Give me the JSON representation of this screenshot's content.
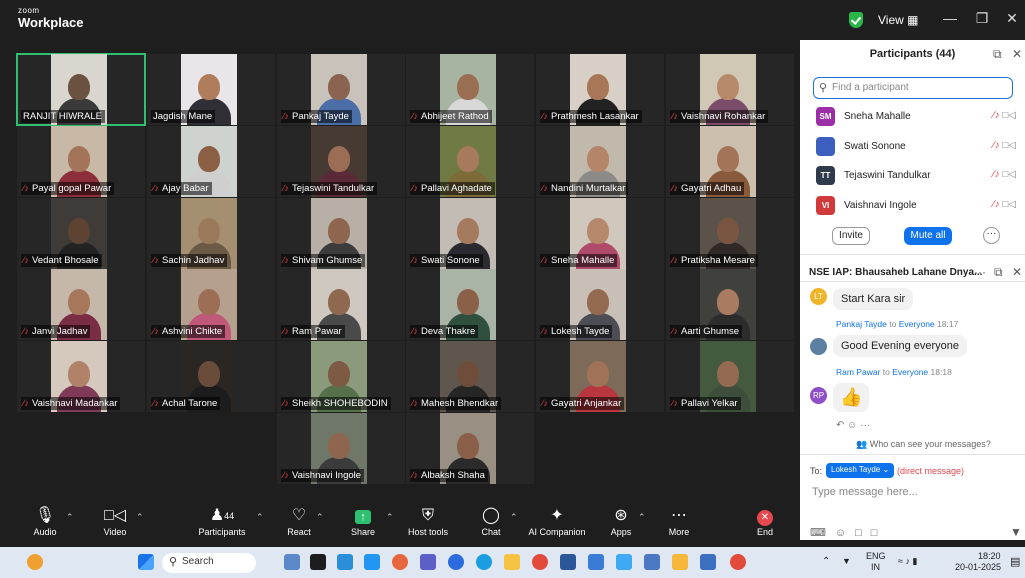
{
  "titlebar": {
    "brand_small": "zoom",
    "brand_big": "Workplace",
    "view_label": "View ▦"
  },
  "gallery": {
    "tiles": [
      {
        "name": "RANJIT HIWRALE",
        "mic_muted": false,
        "active": true,
        "skin": "#6b5140",
        "shirt": "#3a3a3a",
        "bg": "#d9d6cf"
      },
      {
        "name": "Jagdish Mane",
        "mic_muted": false,
        "active": false,
        "skin": "#b07d5c",
        "shirt": "#2f2f35",
        "bg": "#e9e6ea"
      },
      {
        "name": "Pankaj Tayde",
        "mic_muted": true,
        "active": false,
        "skin": "#8a6450",
        "shirt": "#4b6ea8",
        "bg": "#c9c2ba"
      },
      {
        "name": "Abhijeet Rathod",
        "mic_muted": true,
        "active": false,
        "skin": "#9a6e52",
        "shirt": "#d8d8d8",
        "bg": "#a7b4a2"
      },
      {
        "name": "Prathmesh Lasankar",
        "mic_muted": true,
        "active": false,
        "skin": "#a77758",
        "shirt": "#222",
        "bg": "#d8cfc6"
      },
      {
        "name": "Vaishnavi Rohankar",
        "mic_muted": true,
        "active": false,
        "skin": "#b88a6c",
        "shirt": "#7a4d6b",
        "bg": "#d1c7b5"
      },
      {
        "name": "Payal gopal Pawar",
        "mic_muted": true,
        "active": false,
        "skin": "#a3745a",
        "shirt": "#8c2f3a",
        "bg": "#c8b9a7"
      },
      {
        "name": "Ajay Babar",
        "mic_muted": true,
        "active": false,
        "skin": "#8a5f44",
        "shirt": "#cfcfcf",
        "bg": "#cfd3d0"
      },
      {
        "name": "Tejaswini Tandulkar",
        "mic_muted": true,
        "active": false,
        "skin": "#9c6d55",
        "shirt": "#5b2a38",
        "bg": "#473a33"
      },
      {
        "name": "Pallavi Aghadate",
        "mic_muted": true,
        "active": false,
        "skin": "#a87a5d",
        "shirt": "#7d6b3a",
        "bg": "#6f7a44"
      },
      {
        "name": "Nandini Murtalkar",
        "mic_muted": true,
        "active": false,
        "skin": "#b48569",
        "shirt": "#8d8b88",
        "bg": "#c1b9ac"
      },
      {
        "name": "Gayatri Adhau",
        "mic_muted": true,
        "active": false,
        "skin": "#a47458",
        "shirt": "#8a5a3d",
        "bg": "#cdbfae"
      },
      {
        "name": "Vedant Bhosale",
        "mic_muted": true,
        "active": false,
        "skin": "#5e4232",
        "shirt": "#232323",
        "bg": "#3f3b38"
      },
      {
        "name": "Sachin Jadhav",
        "mic_muted": true,
        "active": false,
        "skin": "#9b7a5c",
        "shirt": "#6b5a45",
        "bg": "#a58f71"
      },
      {
        "name": "Shivam Ghumse",
        "mic_muted": true,
        "active": false,
        "skin": "#8e6650",
        "shirt": "#3c3c3c",
        "bg": "#b8b0a6"
      },
      {
        "name": "Swati Sonone",
        "mic_muted": true,
        "active": false,
        "skin": "#a57a5f",
        "shirt": "#2a2a30",
        "bg": "#c2bcb4"
      },
      {
        "name": "Sneha Mahalle",
        "mic_muted": true,
        "active": false,
        "skin": "#b7896c",
        "shirt": "#b04a6a",
        "bg": "#d1c8bd"
      },
      {
        "name": "Pratiksha Mesare",
        "mic_muted": true,
        "active": false,
        "skin": "#7a5642",
        "shirt": "#2f2a28",
        "bg": "#5b524a"
      },
      {
        "name": "Janvi Jadhav",
        "mic_muted": true,
        "active": false,
        "skin": "#a7775b",
        "shirt": "#7a2e45",
        "bg": "#c5b8aa"
      },
      {
        "name": "Ashvini Chikte",
        "mic_muted": true,
        "active": false,
        "skin": "#9c6e55",
        "shirt": "#c0587a",
        "bg": "#b4a08c"
      },
      {
        "name": "Ram Pawar",
        "mic_muted": true,
        "active": false,
        "skin": "#8f6850",
        "shirt": "#4a4a4a",
        "bg": "#cfc8c0"
      },
      {
        "name": "Deva Thakre",
        "mic_muted": true,
        "active": false,
        "skin": "#8a6048",
        "shirt": "#2f4f3f",
        "bg": "#a9b4a6"
      },
      {
        "name": "Lokesh Tayde",
        "mic_muted": true,
        "active": false,
        "skin": "#93694f",
        "shirt": "#4d4d55",
        "bg": "#c8c0b6"
      },
      {
        "name": "Aarti Ghumse",
        "mic_muted": true,
        "active": false,
        "skin": "#a97c62",
        "shirt": "#2c2c2c",
        "bg": "#40403c"
      },
      {
        "name": "Vaishnavi Madankar",
        "mic_muted": true,
        "active": false,
        "skin": "#b0826a",
        "shirt": "#7f3a58",
        "bg": "#d4c9bc"
      },
      {
        "name": "Achal Tarone",
        "mic_muted": true,
        "active": false,
        "skin": "#6a4c3a",
        "shirt": "#1c1c1c",
        "bg": "#2a2623"
      },
      {
        "name": "Sheikh SHOHEBODIN",
        "mic_muted": true,
        "active": false,
        "skin": "#7d5a44",
        "shirt": "#55704a",
        "bg": "#8c9a7c"
      },
      {
        "name": "Mahesh Bhendkar",
        "mic_muted": true,
        "active": false,
        "skin": "#6e4e3a",
        "shirt": "#262626",
        "bg": "#5f564d"
      },
      {
        "name": "Gayatri Anjankar",
        "mic_muted": true,
        "active": false,
        "skin": "#a07258",
        "shirt": "#b8363e",
        "bg": "#7e6a58"
      },
      {
        "name": "Pallavi Yelkar",
        "mic_muted": true,
        "active": false,
        "skin": "#946a52",
        "shirt": "#3d4e3c",
        "bg": "#445a3e"
      },
      {
        "name": "Vaishnavi Ingole",
        "mic_muted": true,
        "active": false,
        "skin": "#8e664f",
        "shirt": "#3b3b3b",
        "bg": "#6f7768"
      },
      {
        "name": "Albaksh Shaha",
        "mic_muted": true,
        "active": false,
        "skin": "#8b6049",
        "shirt": "#2a2a2a",
        "bg": "#998f83"
      }
    ]
  },
  "participants_panel": {
    "title": "Participants (44)",
    "search_placeholder": "Find a participant",
    "list": [
      {
        "initials": "SM",
        "name": "Sneha Mahalle",
        "color": "#9c2fa8"
      },
      {
        "initials": "",
        "name": "Swati Sonone",
        "color": "#3c5fbf"
      },
      {
        "initials": "TT",
        "name": "Tejaswini Tandulkar",
        "color": "#2f3a4a"
      },
      {
        "initials": "VI",
        "name": "Vaishnavi Ingole",
        "color": "#d03a3a"
      }
    ],
    "invite_label": "Invite",
    "mute_all_label": "Mute all",
    "more_label": "···"
  },
  "chat_panel": {
    "title": "NSE IAP: Bhausaheb Lahane Dnya...",
    "messages": [
      {
        "avatar": "LT",
        "avatar_color": "#f0b429",
        "sender": "",
        "recipient": "",
        "time": "",
        "text": "Start Kara sir"
      },
      {
        "avatar": "",
        "avatar_color": "#5a7fa0",
        "sender": "Pankaj Tayde",
        "recipient": "Everyone",
        "time": "18:17",
        "text": "Good Evening everyone"
      },
      {
        "avatar": "RP",
        "avatar_color": "#8e4fc7",
        "sender": "Ram Pawar",
        "recipient": "Everyone",
        "time": "18:18",
        "text": "👍"
      }
    ],
    "to_word": "to",
    "visibility_note": "Who can see your messages?",
    "to_label": "To:",
    "recipient": "Lokesh Tayde ⌄",
    "direct_label": "(direct message)",
    "input_placeholder": "Type message here..."
  },
  "toolbar": {
    "audio": "Audio",
    "video": "Video",
    "participants": "Participants",
    "participants_count": "44",
    "react": "React",
    "share": "Share",
    "host_tools": "Host tools",
    "chat": "Chat",
    "ai_companion": "AI Companion",
    "apps": "Apps",
    "more": "More",
    "end": "End"
  },
  "taskbar": {
    "search_label": "Search",
    "lang_top": "ENG",
    "lang_bottom": "IN",
    "time": "18:20",
    "date": "20-01-2025"
  }
}
